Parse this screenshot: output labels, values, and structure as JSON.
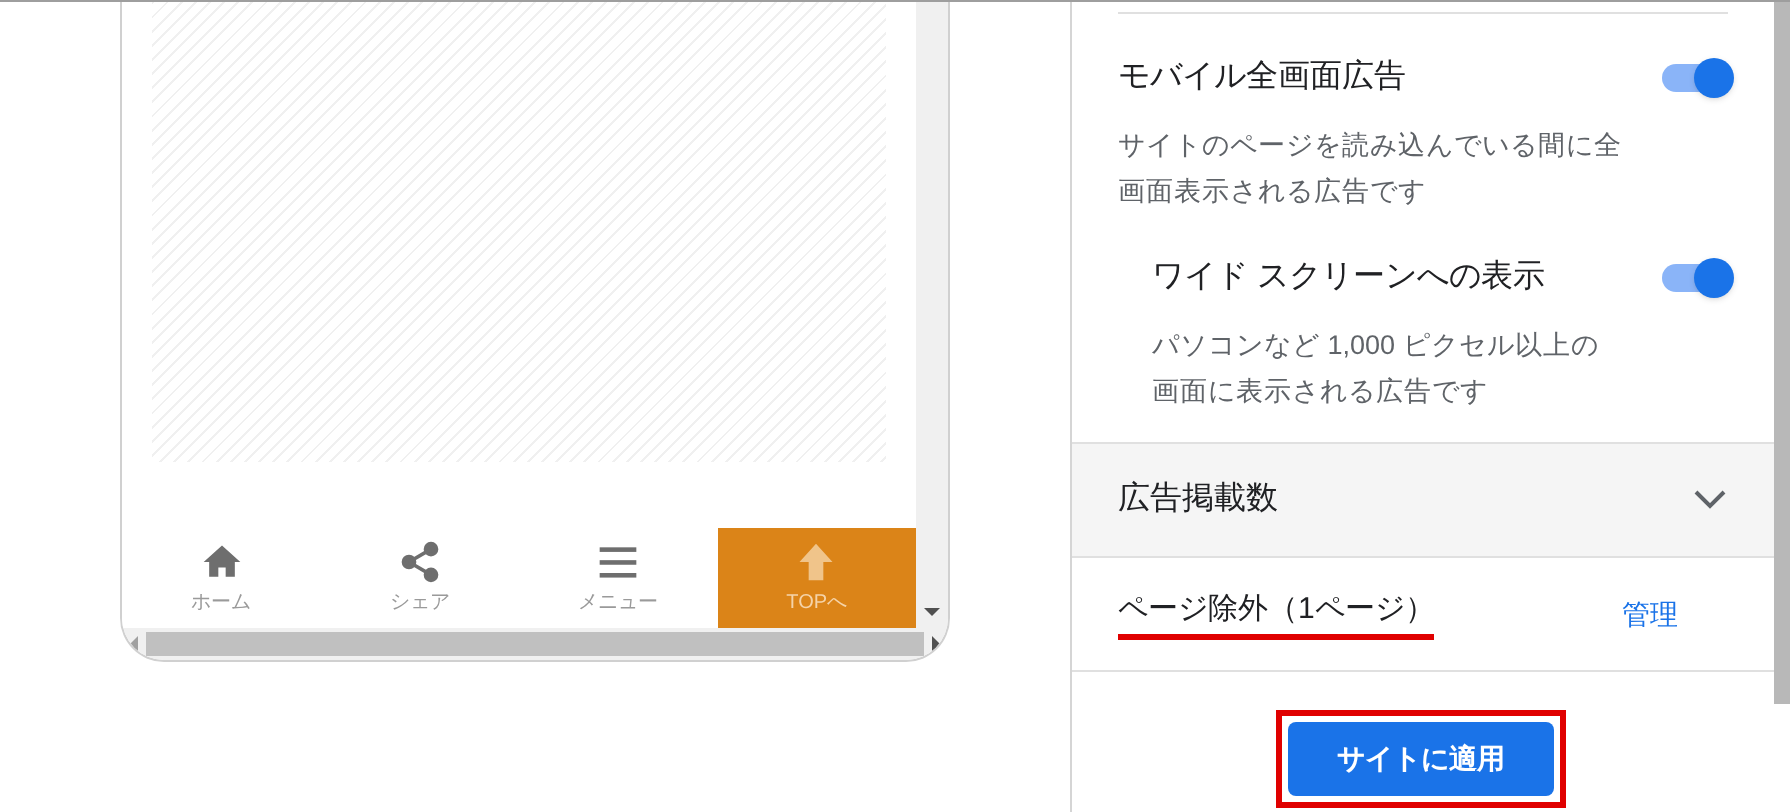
{
  "preview": {
    "nav_items": [
      {
        "label": "ホーム",
        "kind": "home",
        "selected": false
      },
      {
        "label": "シェア",
        "kind": "share",
        "selected": false
      },
      {
        "label": "メニュー",
        "kind": "menu",
        "selected": false
      },
      {
        "label": "TOPへ",
        "kind": "top",
        "selected": true
      }
    ]
  },
  "settings": {
    "toggles": [
      {
        "title": "モバイル全画面広告",
        "description": "サイトのページを読み込んでいる間に全画面表示される広告です",
        "on": true,
        "nested": false
      },
      {
        "title": "ワイド スクリーンへの表示",
        "description": "パソコンなど 1,000 ピクセル以上の画面に表示される広告です",
        "on": true,
        "nested": true
      }
    ],
    "accordion": {
      "title": "広告掲載数",
      "expanded": false
    },
    "exclusion": {
      "label": "ページ除外（1ページ）",
      "link": "管理"
    },
    "apply_button": "サイトに適用"
  }
}
